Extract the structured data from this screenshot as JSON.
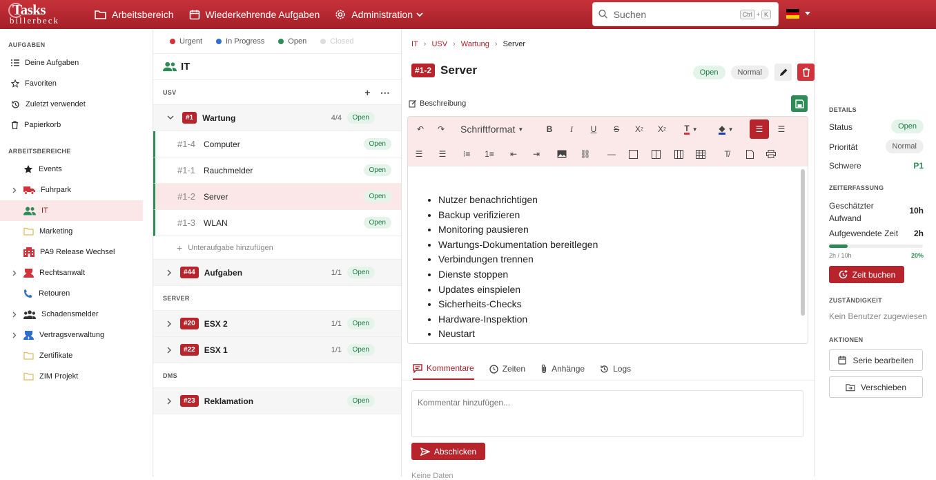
{
  "app": {
    "logo_title": "Tasks",
    "logo_sub": "billerbeck",
    "nav": [
      "Arbeitsbereich",
      "Wiederkehrende Aufgaben",
      "Administration"
    ],
    "search_placeholder": "Suchen",
    "kbd_ctrl": "Ctrl",
    "kbd_plus": "+",
    "kbd_k": "K",
    "accent": "#b8242c"
  },
  "sidebar": {
    "tasks_heading": "AUFGABEN",
    "task_items": [
      "Deine Aufgaben",
      "Favoriten",
      "Zuletzt verwendet",
      "Papierkorb"
    ],
    "ws_heading": "ARBEITSBEREICHE",
    "ws_items": [
      "Events",
      "Fuhrpark",
      "IT",
      "Marketing",
      "PA9 Release Wechsel",
      "Rechtsanwalt",
      "Retouren",
      "Schadensmelder",
      "Vertragsverwaltung",
      "Zertifikate",
      "ZIM Projekt"
    ]
  },
  "list": {
    "legend": [
      {
        "label": "Urgent",
        "color": "#d2333b"
      },
      {
        "label": "In Progress",
        "color": "#2f6fd0"
      },
      {
        "label": "Open",
        "color": "#2e8b57"
      },
      {
        "label": "Closed",
        "color": "#dddddd"
      }
    ],
    "title": "IT",
    "sections": [
      {
        "name": "USV",
        "plus": "+",
        "more": "⋯"
      },
      {
        "name": "SERVER"
      },
      {
        "name": "DMS"
      }
    ],
    "groups": [
      {
        "tag": "#1",
        "name": "Wartung",
        "count": "4/4",
        "status": "Open"
      },
      {
        "tag": "#44",
        "name": "Aufgaben",
        "count": "1/1",
        "status": "Open"
      },
      {
        "tag": "#20",
        "name": "ESX 2",
        "count": "1/1",
        "status": "Open"
      },
      {
        "tag": "#22",
        "name": "ESX 1",
        "count": "1/1",
        "status": "Open"
      },
      {
        "tag": "#23",
        "name": "Reklamation",
        "status": "Open"
      }
    ],
    "subtasks": [
      {
        "id": "#1-4",
        "name": "Computer",
        "status": "Open"
      },
      {
        "id": "#1-1",
        "name": "Rauchmelder",
        "status": "Open"
      },
      {
        "id": "#1-2",
        "name": "Server",
        "status": "Open"
      },
      {
        "id": "#1-3",
        "name": "WLAN",
        "status": "Open"
      }
    ],
    "add_subtask": "Unteraufgabe hinzufügen",
    "add_plus": "+"
  },
  "detail": {
    "breadcrumb": [
      "IT",
      "USV",
      "Wartung",
      "Server"
    ],
    "crumb_sep": "›",
    "tag": "#1-2",
    "title": "Server",
    "status": "Open",
    "priority": "Normal",
    "desc_label": "Beschreibung",
    "toolbar_format": "Schriftformat",
    "bullets": [
      "Nutzer benachrichtigen",
      "Backup verifizieren",
      "Monitoring pausieren",
      "Wartungs-Dokumentation bereitlegen",
      "Verbindungen trennen",
      "Dienste stoppen",
      "Updates einspielen",
      "Sicherheits-Checks",
      "Hardware-Inspektion",
      "Neustart"
    ],
    "tabs": [
      "Kommentare",
      "Zeiten",
      "Anhänge",
      "Logs"
    ],
    "comment_placeholder": "Kommentar hinzufügen...",
    "send": "Abschicken",
    "nodata": "Keine Daten"
  },
  "right": {
    "details_heading": "DETAILS",
    "status_label": "Status",
    "status_value": "Open",
    "prio_label": "Priorität",
    "prio_value": "Normal",
    "severity_label": "Schwere",
    "severity_value": "P1",
    "time_heading": "ZEITERFASSUNG",
    "est_label": "Geschätzter Aufwand",
    "est_value": "10h",
    "spent_label": "Aufgewendete Zeit",
    "spent_value": "2h",
    "progress_text": "2h / 10h",
    "progress_pct": "20%",
    "progress_fraction": 0.2,
    "book_time": "Zeit buchen",
    "resp_heading": "ZUSTÄNDIGKEIT",
    "resp_value": "Kein Benutzer zugewiesen",
    "actions_heading": "AKTIONEN",
    "edit_series": "Serie bearbeiten",
    "move": "Verschieben"
  }
}
